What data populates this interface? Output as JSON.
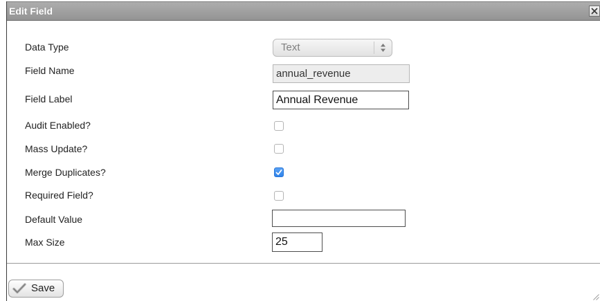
{
  "dialog": {
    "title": "Edit Field"
  },
  "form": {
    "data_type": {
      "label": "Data Type",
      "value": "Text"
    },
    "field_name": {
      "label": "Field Name",
      "value": "annual_revenue"
    },
    "field_label": {
      "label": "Field Label",
      "value": "Annual Revenue"
    },
    "audit_enabled": {
      "label": "Audit Enabled?",
      "checked": false
    },
    "mass_update": {
      "label": "Mass Update?",
      "checked": false
    },
    "merge_duplicates": {
      "label": "Merge Duplicates?",
      "checked": true
    },
    "required_field": {
      "label": "Required Field?",
      "checked": false
    },
    "default_value": {
      "label": "Default Value",
      "value": ""
    },
    "max_size": {
      "label": "Max Size",
      "value": "25"
    }
  },
  "footer": {
    "save_label": "Save"
  },
  "icons": {
    "close": "close-icon",
    "select_arrows": "up-down-arrows-icon",
    "checkbox_check": "checkmark-icon",
    "save": "checkmark-icon",
    "resize": "resize-grip-icon"
  },
  "colors": {
    "title_bar": "#9e9e9e",
    "title_text": "#ffffff",
    "checkbox_checked": "#3d8ff0"
  }
}
